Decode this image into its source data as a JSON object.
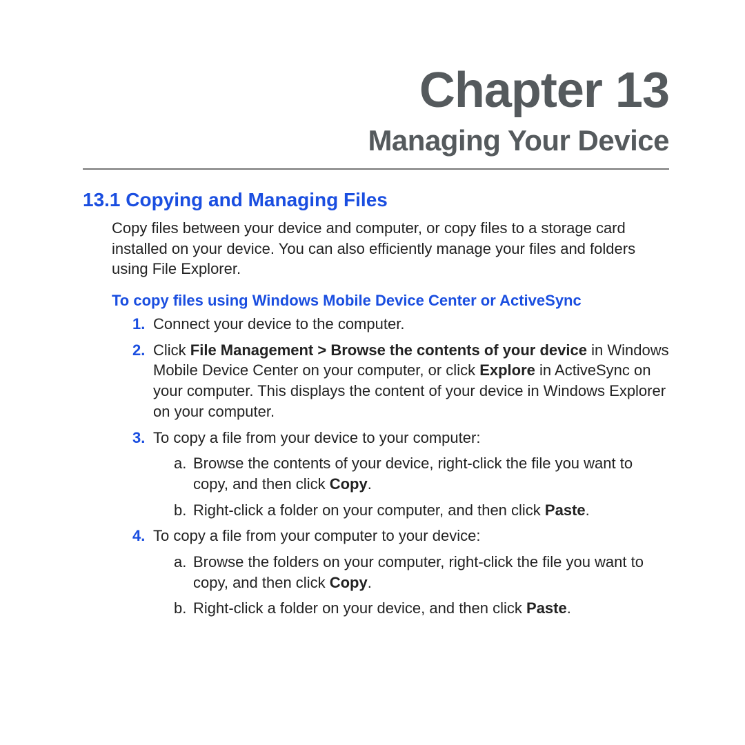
{
  "chapter": {
    "number_label": "Chapter 13",
    "title": "Managing Your Device"
  },
  "section": {
    "heading": "13.1  Copying and Managing Files",
    "intro": "Copy files between your device and computer, or copy files to a storage card installed on your device. You can also efficiently manage your files and folders using File Explorer.",
    "subheading": "To copy files using Windows Mobile Device Center or ActiveSync",
    "steps": {
      "s1": "Connect your device to the computer.",
      "s2_a": "Click ",
      "s2_b_bold": "File Management > Browse the contents of your device",
      "s2_c": " in Windows Mobile Device Center on your computer, or click ",
      "s2_d_bold": "Explore",
      "s2_e": " in ActiveSync on your computer. This displays the content of your device in Windows Explorer on your computer.",
      "s3_intro": "To copy a file from your device to your computer:",
      "s3a_a": "Browse the contents of your device, right-click the file you want to copy, and then click ",
      "s3a_b_bold": "Copy",
      "s3a_c": ".",
      "s3b_a": "Right-click a folder on your computer, and then click ",
      "s3b_b_bold": "Paste",
      "s3b_c": ".",
      "s4_intro": "To copy a file from your computer to your device:",
      "s4a_a": "Browse the folders on your computer, right-click the file you want to copy, and then click ",
      "s4a_b_bold": "Copy",
      "s4a_c": ".",
      "s4b_a": "Right-click a folder on your device, and then click ",
      "s4b_b_bold": "Paste",
      "s4b_c": "."
    }
  }
}
